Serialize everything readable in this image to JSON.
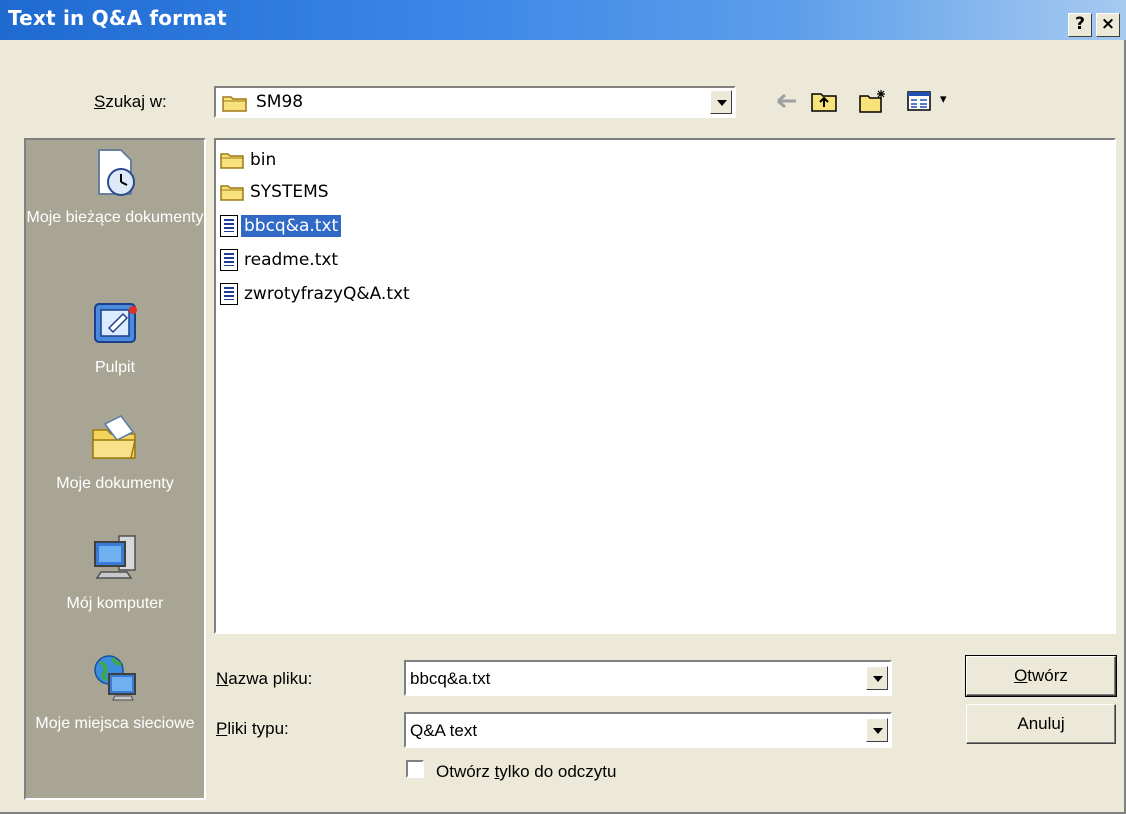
{
  "window": {
    "title": "Text in Q&A format",
    "help_glyph": "?",
    "close_glyph": "×"
  },
  "lookin": {
    "label": "Szukaj w:",
    "accesskey": "S",
    "label_rest": "zukaj w:",
    "value": "SM98"
  },
  "toolbar": {
    "back_glyph": "←",
    "views_caret": "▾"
  },
  "places": [
    {
      "name": "Moje bieżące dokumenty",
      "icon": "recent-documents-icon"
    },
    {
      "name": "Pulpit",
      "icon": "desktop-icon"
    },
    {
      "name": "Moje dokumenty",
      "icon": "my-documents-icon"
    },
    {
      "name": "Mój komputer",
      "icon": "my-computer-icon"
    },
    {
      "name": "Moje miejsca sieciowe",
      "icon": "network-places-icon"
    }
  ],
  "files": [
    {
      "name": "bin",
      "type": "folder",
      "selected": false
    },
    {
      "name": "SYSTEMS",
      "type": "folder",
      "selected": false
    },
    {
      "name": "bbcq&a.txt",
      "type": "text",
      "selected": true
    },
    {
      "name": "readme.txt",
      "type": "text",
      "selected": false
    },
    {
      "name": "zwrotyfrazyQ&A.txt",
      "type": "text",
      "selected": false
    }
  ],
  "filename": {
    "label_key": "N",
    "label_rest": "azwa pliku:",
    "value": "bbcq&a.txt"
  },
  "filetype": {
    "label_key": "P",
    "label_rest": "liki typu:",
    "value": "Q&A text"
  },
  "buttons": {
    "open_key": "O",
    "open_rest": "twórz",
    "cancel": "Anuluj"
  },
  "readonly": {
    "pre": "Otwórz ",
    "key": "t",
    "post": "ylko do odczytu",
    "checked": false
  },
  "colors": {
    "title_bar": "#1F6AD0",
    "selection": "#316AC5",
    "places_bar": "#A9A595",
    "dialog_bg": "#ECE9D8"
  }
}
